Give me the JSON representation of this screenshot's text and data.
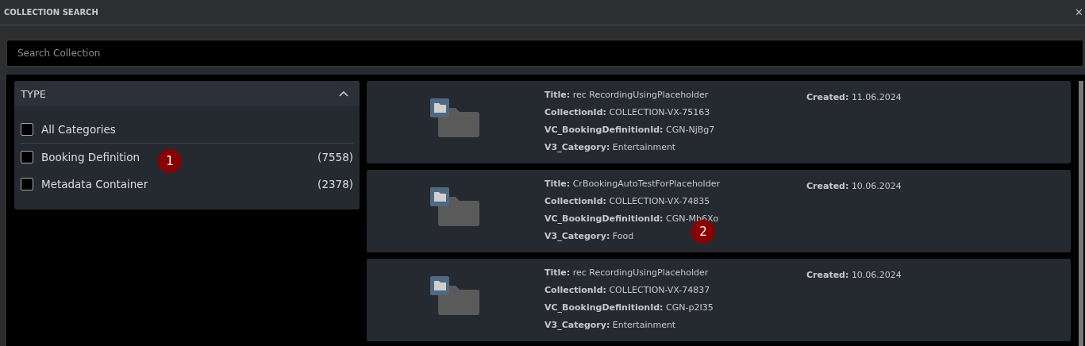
{
  "window": {
    "title": "COLLECTION SEARCH",
    "close": "✕"
  },
  "search": {
    "placeholder": "Search Collection"
  },
  "filter": {
    "title": "TYPE",
    "expanded": true,
    "all": {
      "label": "All Categories",
      "checked": false
    },
    "items": [
      {
        "label": "Booking Definition",
        "count": "(7558)",
        "checked": false
      },
      {
        "label": "Metadata Container",
        "count": "(2378)",
        "checked": false
      }
    ]
  },
  "results": [
    {
      "fields": [
        {
          "label": "Title:",
          "value": "rec RecordingUsingPlaceholder"
        },
        {
          "label": "CollectionId:",
          "value": "COLLECTION-VX-75163"
        },
        {
          "label": "VC_BookingDefinitionId:",
          "value": "CGN-NjBg7"
        },
        {
          "label": "V3_Category:",
          "value": "Entertainment"
        }
      ],
      "created": {
        "label": "Created:",
        "value": "11.06.2024"
      }
    },
    {
      "fields": [
        {
          "label": "Title:",
          "value": "CrBookingAutoTestForPlaceholder"
        },
        {
          "label": "CollectionId:",
          "value": "COLLECTION-VX-74835"
        },
        {
          "label": "VC_BookingDefinitionId:",
          "value": "CGN-Mb6Xo"
        },
        {
          "label": "V3_Category:",
          "value": "Food"
        }
      ],
      "created": {
        "label": "Created:",
        "value": "10.06.2024"
      }
    },
    {
      "fields": [
        {
          "label": "Title:",
          "value": "rec RecordingUsingPlaceholder"
        },
        {
          "label": "CollectionId:",
          "value": "COLLECTION-VX-74837"
        },
        {
          "label": "VC_BookingDefinitionId:",
          "value": "CGN-p2I35"
        },
        {
          "label": "V3_Category:",
          "value": "Entertainment"
        }
      ],
      "created": {
        "label": "Created:",
        "value": "10.06.2024"
      }
    }
  ],
  "markers": [
    "1",
    "2"
  ]
}
